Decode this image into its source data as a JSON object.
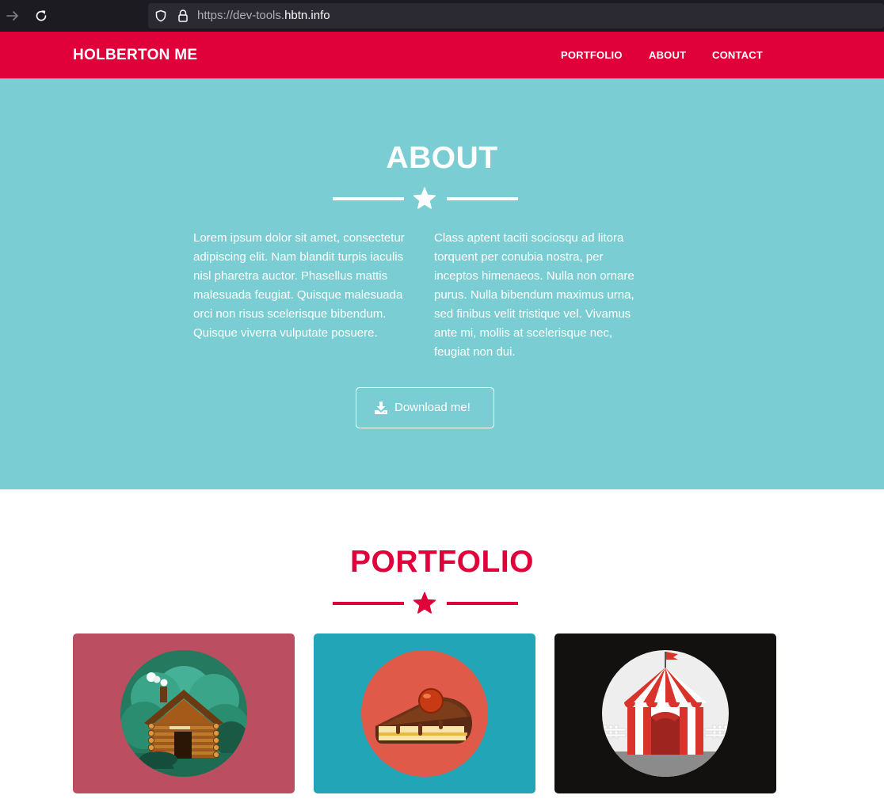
{
  "browser": {
    "url_prefix": "https://dev-tools.",
    "url_domain": "hbtn.info"
  },
  "navbar": {
    "brand": "HOLBERTON ME",
    "links": [
      {
        "label": "PORTFOLIO"
      },
      {
        "label": "ABOUT"
      },
      {
        "label": "CONTACT"
      }
    ],
    "color": "#e0003a"
  },
  "about": {
    "title": "ABOUT",
    "background": "#79cdd3",
    "left_text": "Lorem ipsum dolor sit amet, consectetur adipiscing elit. Nam blandit turpis iaculis nisl pharetra auctor. Phasellus mattis malesuada feugiat. Quisque malesuada orci non risus scelerisque bibendum. Quisque viverra vulputate posuere.",
    "right_text": "Class aptent taciti sociosqu ad litora torquent per conubia nostra, per inceptos himenaeos. Nulla non ornare purus. Nulla bibendum maximus urna, sed finibus velit tristique vel. Vivamus ante mi, mollis at scelerisque nec, feugiat non dui.",
    "button_label": "Download me!",
    "button_icon": "download-icon"
  },
  "portfolio": {
    "title": "PORTFOLIO",
    "items": [
      {
        "icon": "cabin-icon",
        "background": "#bb4f61"
      },
      {
        "icon": "cake-icon",
        "background": "#22a5b7"
      },
      {
        "icon": "circus-tent-icon",
        "background": "#131010"
      }
    ]
  }
}
